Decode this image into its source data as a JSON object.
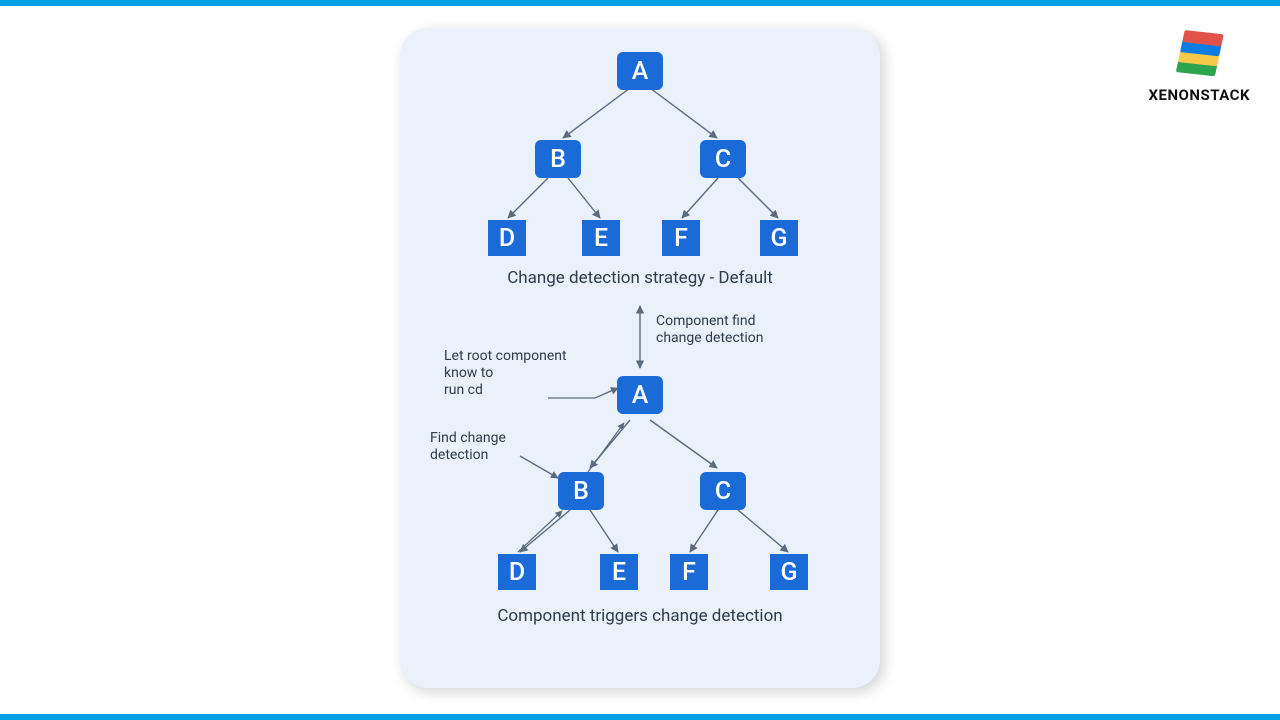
{
  "brand": {
    "name": "XENONSTACK"
  },
  "colors": {
    "accent_bar": "#009fe3",
    "panel_bg": "#eaf1fb",
    "node_fill": "#1a6bd8",
    "text": "#2e3b4e"
  },
  "diagram": {
    "tree1": {
      "nodes": {
        "A": "A",
        "B": "B",
        "C": "C",
        "D": "D",
        "E": "E",
        "F": "F",
        "G": "G"
      },
      "caption": "Change detection strategy - Default"
    },
    "transition": {
      "label": "Component find\nchange detection"
    },
    "tree2": {
      "nodes": {
        "A": "A",
        "B": "B",
        "C": "C",
        "D": "D",
        "E": "E",
        "F": "F",
        "G": "G"
      },
      "caption": "Component triggers change detection",
      "annot_root": "Let root component\nknow to\nrun cd",
      "annot_find": "Find change\ndetection"
    }
  }
}
